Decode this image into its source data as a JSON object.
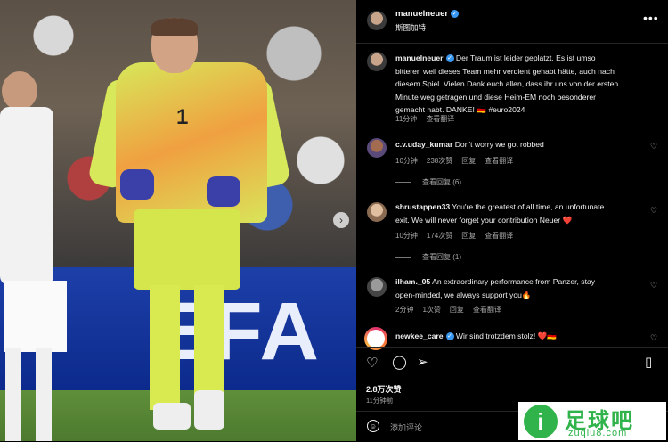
{
  "post": {
    "owner": "manuelneuer",
    "location": "斯图加特",
    "caption_user": "manuelneuer",
    "caption_lines": [
      "Der Traum ist leider geplatzt. Es ist umso",
      "bitterer, weil dieses Team mehr verdient gehabt hätte, auch nach",
      "diesem Spiel. Vielen Dank euch allen, dass ihr uns von der ersten",
      "Minute weg getragen und diese Heim-EM noch besonderer",
      "gemacht habt. DANKE! 🇩🇪 #euro2024"
    ],
    "caption_time": "11分钟",
    "caption_translate": "查看翻译",
    "likes": "2.8万次赞",
    "date": "11分钟前",
    "comment_placeholder": "添加评论..."
  },
  "comments": [
    {
      "user": "c.v.uday_kumar",
      "text": "Don't worry we got robbed",
      "time": "10分钟",
      "likes": "238次赞",
      "reply": "回复",
      "translate": "查看翻译",
      "view_replies": "查看回复 (6)"
    },
    {
      "user": "shrustappen33",
      "text": "You're the greatest of all time, an unfortunate",
      "text2": "exit. We will never forget your contribution Neuer ❤️",
      "time": "10分钟",
      "likes": "174次赞",
      "reply": "回复",
      "translate": "查看翻译",
      "view_replies": "查看回复 (1)"
    },
    {
      "user": "ilham._05",
      "text": "An extraordinary performance from Panzer, stay",
      "text2": "open-minded, we always support you🔥",
      "time": "2分钟",
      "likes": "1次赞",
      "reply": "回复",
      "translate": "查看翻译"
    },
    {
      "user": "newkee_care",
      "text": "Wir sind trotzdem stolz! ❤️🇩🇪"
    }
  ],
  "photo": {
    "jersey_number": "1",
    "board_text": "EFA"
  },
  "watermark": {
    "brand": "足球吧",
    "url": "zuqiu8.com",
    "mark": "i"
  },
  "icons": {
    "more": "more-icon",
    "heart": "heart-icon",
    "comment": "comment-icon",
    "share": "share-icon",
    "save": "bookmark-icon",
    "emoji": "emoji-icon",
    "next": "chevron-right-icon"
  }
}
